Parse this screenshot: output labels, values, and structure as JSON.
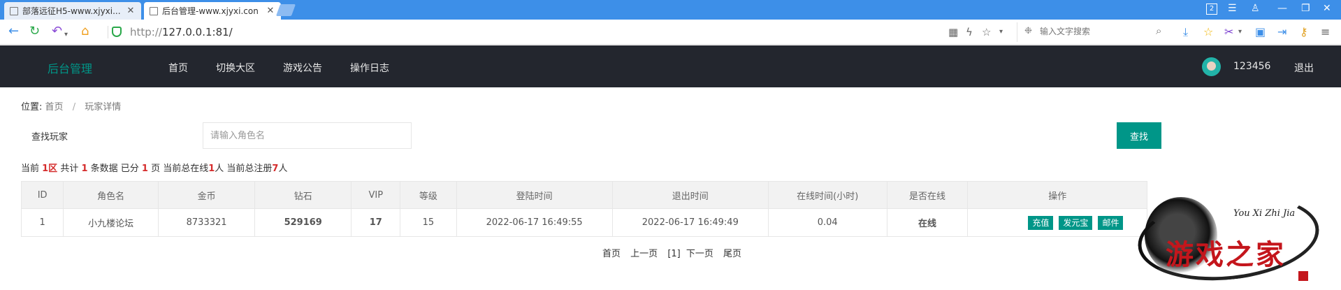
{
  "browser": {
    "tabs": [
      {
        "title": "部落远征H5-www.xjyxi...",
        "active": false
      },
      {
        "title": "后台管理-www.xjyxi.con",
        "active": true
      }
    ],
    "window_badge": "2",
    "url_protocol": "http://",
    "url_host": "127.0.0.1:81/",
    "search_placeholder": "输入文字搜索"
  },
  "header": {
    "brand": "后台管理",
    "nav": [
      "首页",
      "切换大区",
      "游戏公告",
      "操作日志"
    ],
    "username": "123456",
    "logout": "退出"
  },
  "breadcrumb": {
    "label": "位置:",
    "items": [
      "首页",
      "玩家详情"
    ]
  },
  "search": {
    "label": "查找玩家",
    "placeholder": "请输入角色名",
    "button": "查找"
  },
  "stats": {
    "t1": "当前 ",
    "region": "1区",
    "t2": " 共计 ",
    "total": "1",
    "t3": " 条数据 已分 ",
    "pages": "1",
    "t4": " 页 当前总在线",
    "online": "1",
    "t5": "人 当前总注册",
    "registered": "7",
    "t6": "人"
  },
  "table": {
    "columns": [
      "ID",
      "角色名",
      "金币",
      "钻石",
      "VIP",
      "等级",
      "登陆时间",
      "退出时间",
      "在线时间(小时)",
      "是否在线",
      "操作"
    ],
    "rows": [
      {
        "id": "1",
        "name": "小九楼论坛",
        "gold": "8733321",
        "diamond": "529169",
        "vip": "17",
        "level": "15",
        "login": "2022-06-17 16:49:55",
        "logout": "2022-06-17 16:49:49",
        "online_hours": "0.04",
        "is_online": "在线",
        "actions": [
          "充值",
          "发元宝",
          "邮件"
        ]
      }
    ]
  },
  "pager": {
    "first": "首页",
    "prev": "上一页",
    "current": "[1]",
    "next": "下一页",
    "last": "尾页"
  },
  "watermark": {
    "sub": "You Xi Zhi Jia",
    "title": "游戏之家"
  },
  "colors": {
    "accent": "#009688",
    "header_bg": "#23262e",
    "highlight_red": "#d52c2c",
    "diamond_green": "#33cc33",
    "tabbar_blue": "#3d8fe8"
  }
}
